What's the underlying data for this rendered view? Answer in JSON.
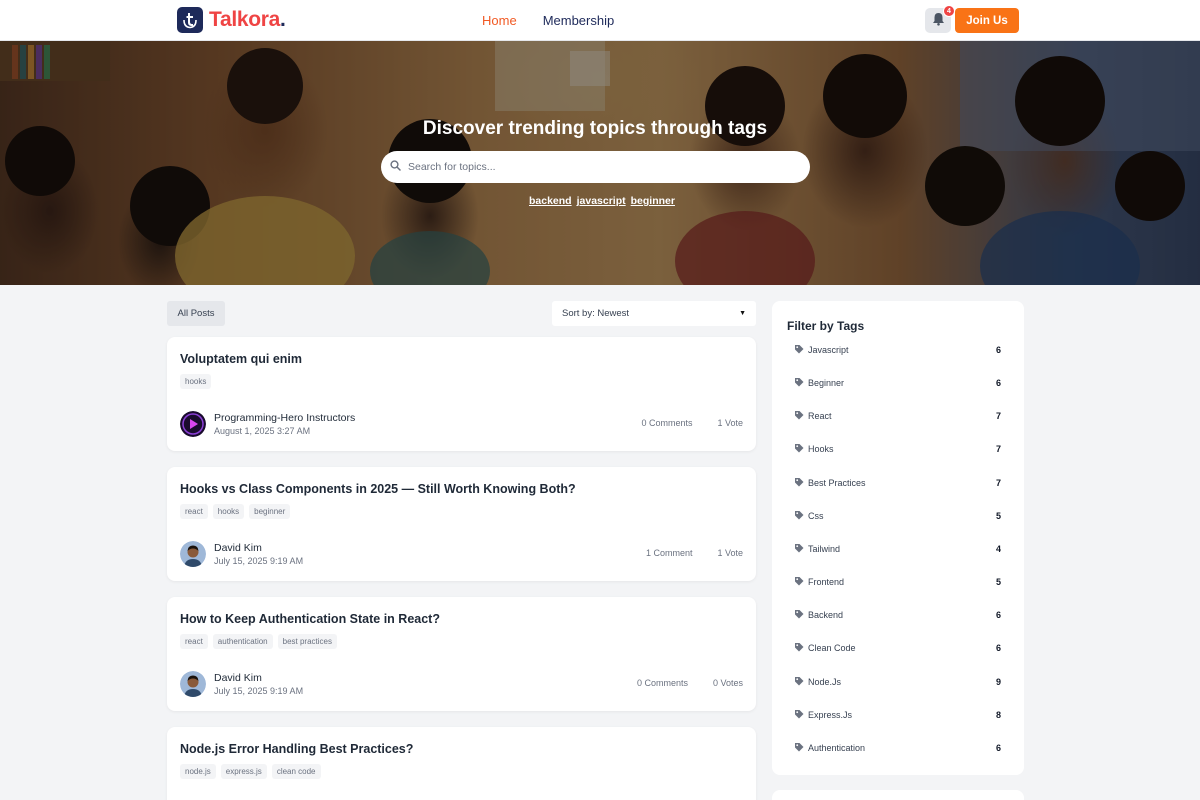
{
  "brand": {
    "name": "Talkora",
    "dot": ".",
    "accent": "#f15a24",
    "primary": "#1e2a5a"
  },
  "nav": {
    "links": [
      {
        "label": "Home",
        "active": true
      },
      {
        "label": "Membership",
        "active": false
      }
    ]
  },
  "notifications": {
    "count": "4",
    "icon": "bell-icon"
  },
  "join_label": "Join Us",
  "hero": {
    "title": "Discover trending topics through tags",
    "search_placeholder": "Search for topics...",
    "tags": [
      "backend",
      "javascript",
      "beginner"
    ]
  },
  "feed": {
    "all_posts_label": "All Posts",
    "sort_label": "Sort by: Newest",
    "posts": [
      {
        "title": "Voluptatem qui enim",
        "tags": [
          "hooks"
        ],
        "author": "Programming-Hero Instructors",
        "date": "August 1, 2025 3:27 AM",
        "comments": "0 Comments",
        "votes": "1 Vote"
      },
      {
        "title": "Hooks vs Class Components in 2025 — Still Worth Knowing Both?",
        "tags": [
          "react",
          "hooks",
          "beginner"
        ],
        "author": "David Kim",
        "date": "July 15, 2025 9:19 AM",
        "comments": "1 Comment",
        "votes": "1 Vote"
      },
      {
        "title": "How to Keep Authentication State in React?",
        "tags": [
          "react",
          "authentication",
          "best practices"
        ],
        "author": "David Kim",
        "date": "July 15, 2025 9:19 AM",
        "comments": "0 Comments",
        "votes": "0 Votes"
      },
      {
        "title": "Node.js Error Handling Best Practices?",
        "tags": [
          "node.js",
          "express.js",
          "clean code"
        ],
        "author": "",
        "date": "",
        "comments": "",
        "votes": ""
      }
    ]
  },
  "sidebar": {
    "title": "Filter by Tags",
    "tags": [
      {
        "label": "Javascript",
        "count": "6"
      },
      {
        "label": "Beginner",
        "count": "6"
      },
      {
        "label": "React",
        "count": "7"
      },
      {
        "label": "Hooks",
        "count": "7"
      },
      {
        "label": "Best Practices",
        "count": "7"
      },
      {
        "label": "Css",
        "count": "5"
      },
      {
        "label": "Tailwind",
        "count": "4"
      },
      {
        "label": "Frontend",
        "count": "5"
      },
      {
        "label": "Backend",
        "count": "6"
      },
      {
        "label": "Clean Code",
        "count": "6"
      },
      {
        "label": "Node.Js",
        "count": "9"
      },
      {
        "label": "Express.Js",
        "count": "8"
      },
      {
        "label": "Authentication",
        "count": "6"
      }
    ]
  }
}
